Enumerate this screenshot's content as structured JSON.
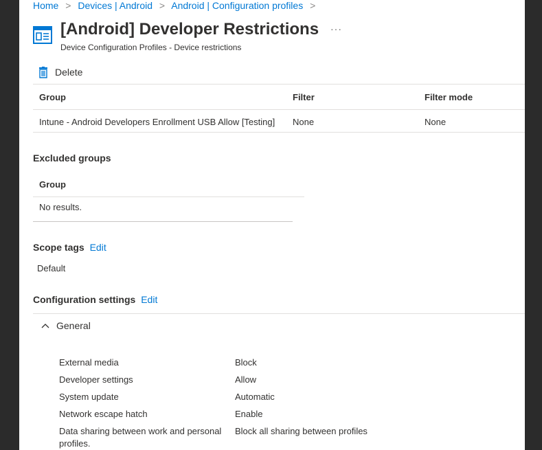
{
  "breadcrumb": {
    "items": [
      "Home",
      "Devices | Android",
      "Android | Configuration profiles"
    ],
    "separator": ">"
  },
  "header": {
    "title": "[Android] Developer Restrictions",
    "subtitle": "Device Configuration Profiles - Device restrictions",
    "more": "···"
  },
  "toolbar": {
    "delete_label": "Delete"
  },
  "included_groups": {
    "columns": [
      "Group",
      "Filter",
      "Filter mode"
    ],
    "rows": [
      [
        "Intune - Android Developers Enrollment USB Allow [Testing]",
        "None",
        "None"
      ]
    ]
  },
  "excluded_groups": {
    "title": "Excluded groups",
    "column": "Group",
    "empty_text": "No results."
  },
  "scope_tags": {
    "title": "Scope tags",
    "edit_label": "Edit",
    "value": "Default"
  },
  "configuration": {
    "title": "Configuration settings",
    "edit_label": "Edit",
    "section_label": "General",
    "settings": [
      {
        "label": "External media",
        "value": "Block"
      },
      {
        "label": "Developer settings",
        "value": "Allow"
      },
      {
        "label": "System update",
        "value": "Automatic"
      },
      {
        "label": "Network escape hatch",
        "value": "Enable"
      },
      {
        "label": "Data sharing between work and personal profiles.",
        "value": "Block all sharing between profiles"
      }
    ]
  },
  "colors": {
    "accent": "#0078d4",
    "text": "#323130",
    "divider": "#e1dfdd",
    "frame": "#2b2b2b"
  }
}
